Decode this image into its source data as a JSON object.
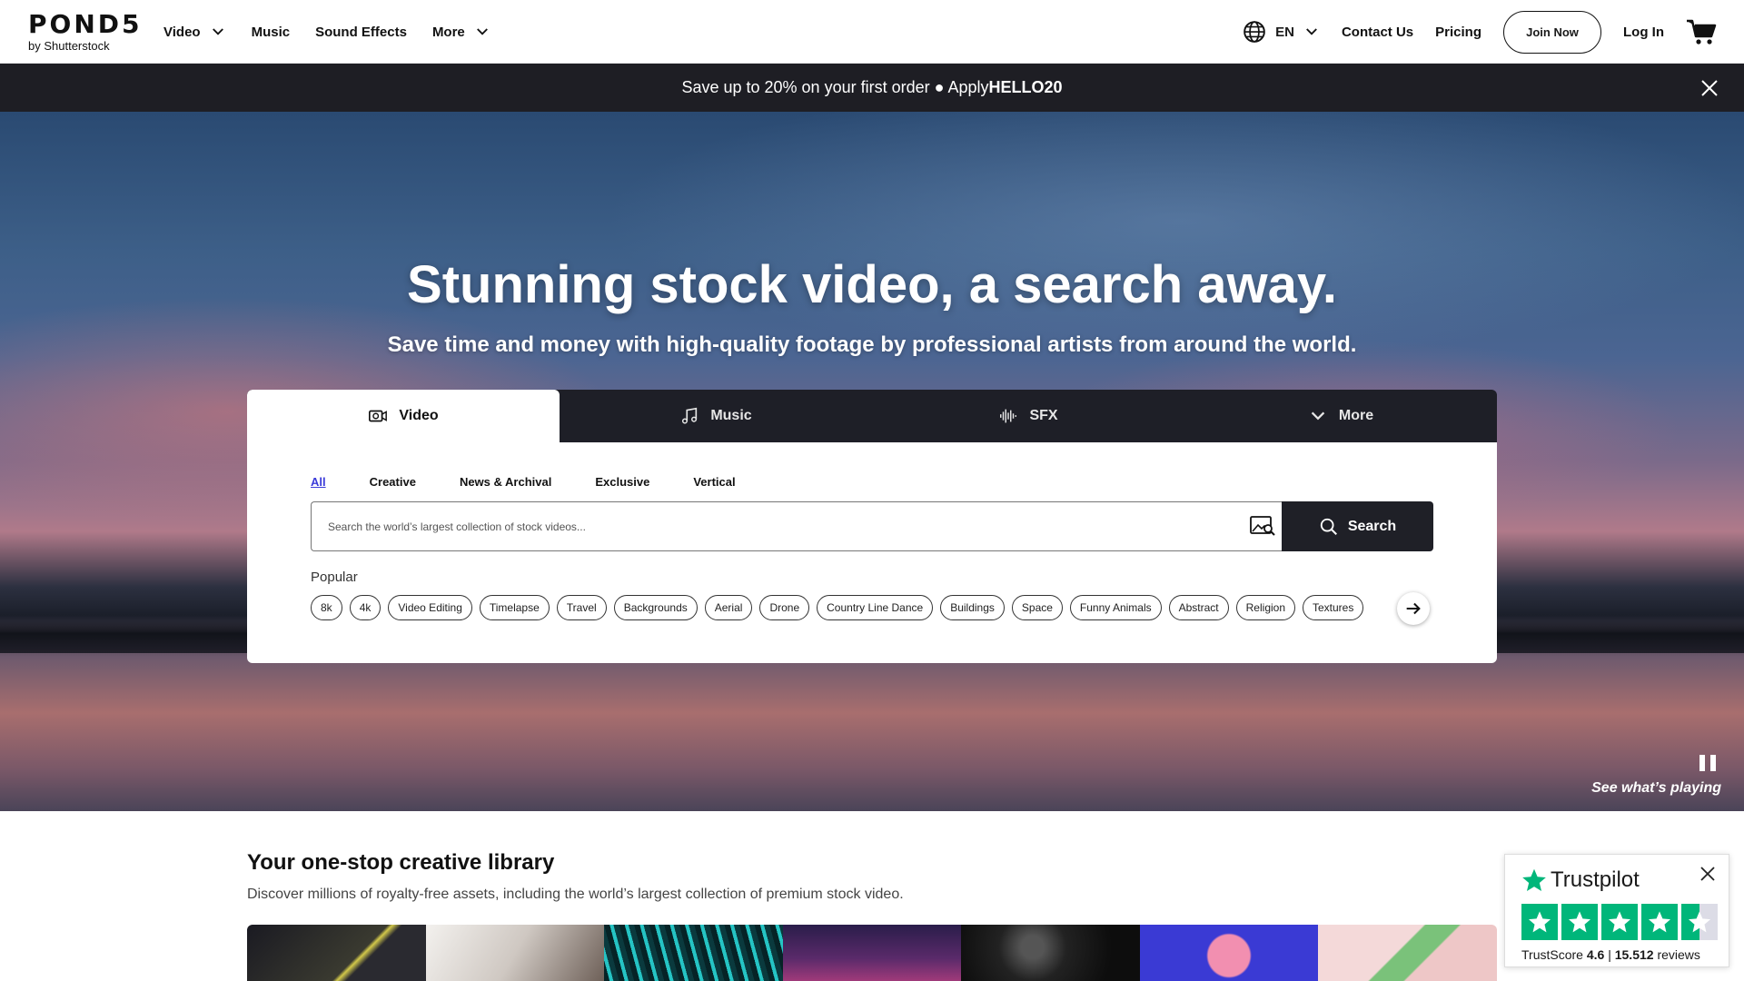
{
  "header": {
    "logo_main": "POND5",
    "logo_sub": "by Shutterstock",
    "nav": [
      {
        "label": "Video",
        "dropdown": true
      },
      {
        "label": "Music",
        "dropdown": false
      },
      {
        "label": "Sound Effects",
        "dropdown": false
      },
      {
        "label": "More",
        "dropdown": true
      }
    ],
    "language": "EN",
    "contact": "Contact Us",
    "pricing": "Pricing",
    "join": "Join Now",
    "login": "Log In"
  },
  "promo": {
    "text": "Save up to 20% on your first order ● Apply ",
    "code": "HELLO20"
  },
  "hero": {
    "title": "Stunning stock video, a search away.",
    "subtitle": "Save time and money with high-quality footage by professional artists from around the world.",
    "see_playing": "See what’s playing"
  },
  "search_card": {
    "tabs": [
      {
        "label": "Video",
        "icon": "video-camera-icon",
        "active": true
      },
      {
        "label": "Music",
        "icon": "music-note-icon",
        "active": false
      },
      {
        "label": "SFX",
        "icon": "sound-wave-icon",
        "active": false
      },
      {
        "label": "More",
        "icon": "chevron-down-icon",
        "active": false
      }
    ],
    "filters": [
      "All",
      "Creative",
      "News & Archival",
      "Exclusive",
      "Vertical"
    ],
    "active_filter": "All",
    "placeholder": "Search the world’s largest collection of stock videos...",
    "search_button": "Search",
    "popular_label": "Popular",
    "popular": [
      "8k",
      "4k",
      "Video Editing",
      "Timelapse",
      "Travel",
      "Backgrounds",
      "Aerial",
      "Drone",
      "Country Line Dance",
      "Buildings",
      "Space",
      "Funny Animals",
      "Abstract",
      "Religion",
      "Textures"
    ]
  },
  "library": {
    "title": "Your one-stop creative library",
    "subtitle": "Discover millions of royalty-free assets, including the world’s largest collection of premium stock video."
  },
  "trustpilot": {
    "brand": "Trustpilot",
    "score_label": "TrustScore",
    "score": "4.6",
    "reviews_count": "15.512",
    "reviews_label": "reviews"
  },
  "colors": {
    "accent_link": "#3b3bd9",
    "dark_bar": "#1e1e24",
    "trustpilot_green": "#00b67a"
  }
}
